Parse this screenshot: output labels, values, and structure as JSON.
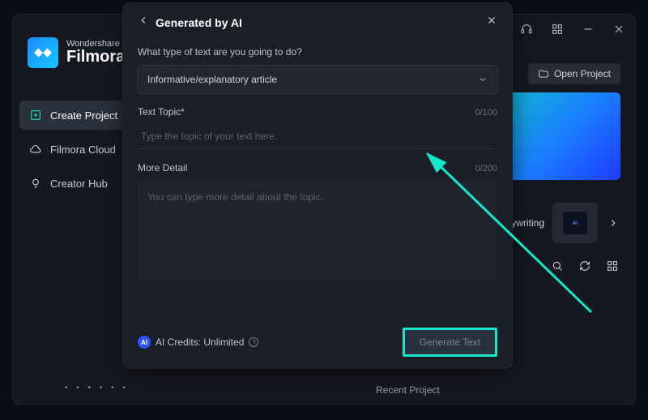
{
  "brand": {
    "line1": "Wondershare",
    "line2": "Filmora"
  },
  "sidebar": {
    "items": [
      {
        "label": "Create Project"
      },
      {
        "label": "Filmora Cloud"
      },
      {
        "label": "Creator Hub"
      }
    ]
  },
  "header": {
    "open_project_label": "Open Project"
  },
  "right_panel": {
    "card_label": "Copywriting",
    "recent_label": "Recent Project"
  },
  "pager_dots": "• • • • • •",
  "modal": {
    "title": "Generated by AI",
    "question": "What type of text are you going to do?",
    "select_value": "Informative/explanatory article",
    "topic_label": "Text Topic*",
    "topic_counter": "0/100",
    "topic_placeholder": "Type the topic of your text here.",
    "detail_label": "More Detail",
    "detail_counter": "0/200",
    "detail_placeholder": "You can type more detail about the topic.",
    "credits_badge": "AI",
    "credits_label": "AI Credits: Unlimited",
    "generate_label": "Generate Text"
  }
}
